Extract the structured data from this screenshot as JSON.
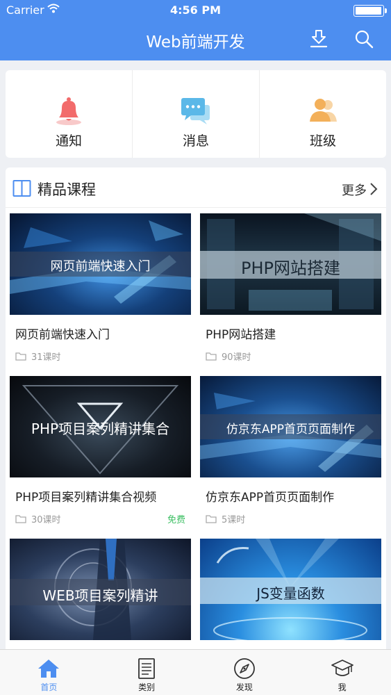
{
  "status_bar": {
    "carrier": "Carrier",
    "time": "4:56 PM",
    "battery_level": 1.0
  },
  "nav": {
    "title": "Web前端开发",
    "download_icon": "download-icon",
    "search_icon": "search-icon"
  },
  "quick_entries": [
    {
      "label": "通知",
      "icon": "bell-icon",
      "color": "#f26b6b"
    },
    {
      "label": "消息",
      "icon": "chat-bubbles-icon",
      "color": "#5bb8e8"
    },
    {
      "label": "班级",
      "icon": "people-icon",
      "color": "#f3b05a"
    }
  ],
  "section": {
    "title": "精品课程",
    "more": "更多",
    "icon": "book-icon"
  },
  "courses": [
    {
      "thumb_text": "网页前端快速入门",
      "title": "网页前端快速入门",
      "hours": "31课时",
      "tag": ""
    },
    {
      "thumb_text": "PHP网站搭建",
      "title": "PHP网站搭建",
      "hours": "90课时",
      "tag": ""
    },
    {
      "thumb_text": "PHP项目案列精讲集合",
      "title": "PHP项目案列精讲集合视频",
      "hours": "30课时",
      "tag": "免费"
    },
    {
      "thumb_text": "仿京东APP首页页面制作",
      "title": "仿京东APP首页页面制作",
      "hours": "5课时",
      "tag": ""
    },
    {
      "thumb_text": "WEB项目案列精讲",
      "title": "",
      "hours": "",
      "tag": ""
    },
    {
      "thumb_text": "JS变量函数",
      "title": "",
      "hours": "",
      "tag": ""
    }
  ],
  "tabs": [
    {
      "label": "首页",
      "icon": "home-icon",
      "active": true
    },
    {
      "label": "类别",
      "icon": "list-icon",
      "active": false
    },
    {
      "label": "发现",
      "icon": "compass-icon",
      "active": false
    },
    {
      "label": "我",
      "icon": "graduation-cap-icon",
      "active": false
    }
  ],
  "colors": {
    "primary": "#4d8ef0",
    "free": "#3cbf63",
    "bell": "#f26b6b",
    "chat": "#5bb8e8",
    "people": "#f3b05a"
  }
}
